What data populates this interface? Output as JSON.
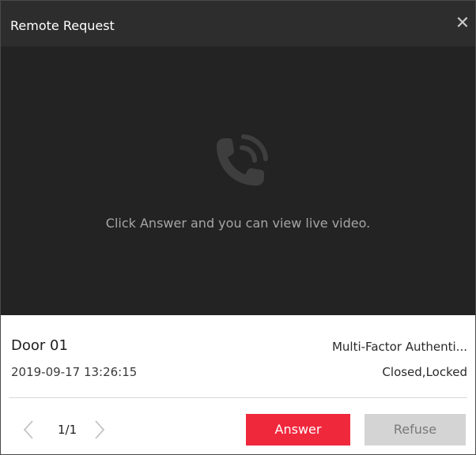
{
  "window": {
    "title": "Remote Request",
    "close_glyph": "✕"
  },
  "video": {
    "icon": "phone-ringing-icon",
    "hint": "Click Answer and you can view live video."
  },
  "info": {
    "door_name": "Door 01",
    "auth_mode": "Multi-Factor Authenti...",
    "timestamp": "2019-09-17 13:26:15",
    "door_status": "Closed,Locked"
  },
  "pager": {
    "prev_icon": "chevron-left-icon",
    "next_icon": "chevron-right-icon",
    "count": "1/1"
  },
  "actions": {
    "answer_label": "Answer",
    "refuse_label": "Refuse"
  },
  "colors": {
    "titlebar": "#2d2d2d",
    "video_bg": "#232323",
    "answer": "#f0283c",
    "refuse": "#d4d4d4"
  }
}
